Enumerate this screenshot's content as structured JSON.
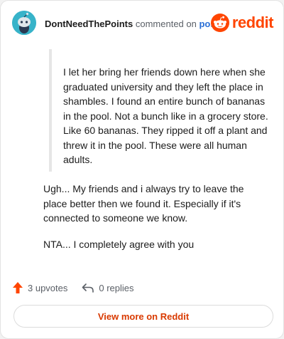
{
  "header": {
    "username": "DontNeedThePoints",
    "action_text": "commented on",
    "post_link": "post",
    "brand": "reddit"
  },
  "quote": {
    "text": "I let her bring her friends down here when she graduated university and they left the place in shambles. I found an entire bunch of bananas in the pool. Not a bunch like in a grocery store. Like 60 bananas. They ripped it off a plant and threw it in the pool. These were all human adults."
  },
  "comment": {
    "paragraphs": [
      "Ugh... My friends and i always try to leave the place better then we found it. Especially if it's connected to someone we know.",
      "NTA... I completely agree with you"
    ]
  },
  "actions": {
    "upvotes_label": "3 upvotes",
    "replies_label": "0 replies"
  },
  "footer": {
    "view_more_label": "View more on Reddit"
  },
  "colors": {
    "brand": "#ff4500",
    "upvote": "#ff4500",
    "link": "#2a6fd6",
    "avatar_bg": "#37b3c9"
  },
  "icons": {
    "avatar": "snoo-avatar-icon",
    "brand": "reddit-logo-icon",
    "upvote": "upvote-arrow-icon",
    "reply": "reply-arrow-icon"
  }
}
